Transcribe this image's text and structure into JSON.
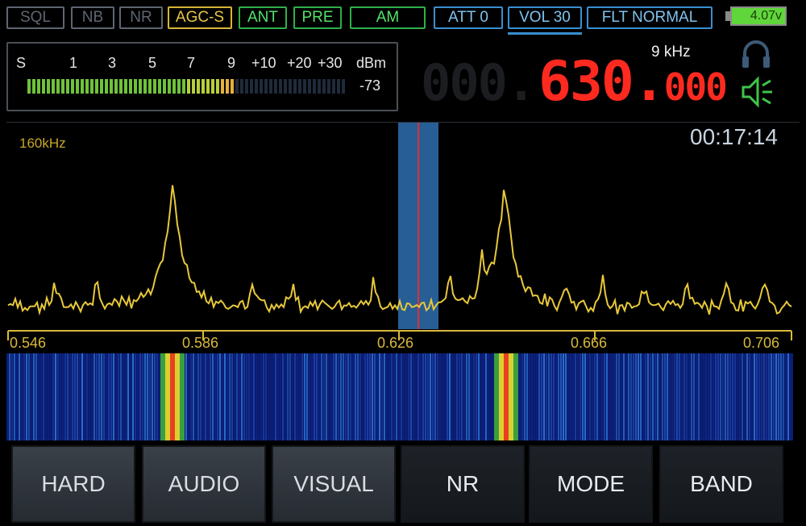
{
  "top_bar": {
    "sql": "SQL",
    "nb": "NB",
    "nr": "NR",
    "agc": "AGC-S",
    "ant": "ANT",
    "pre": "PRE",
    "mode": "AM",
    "att": "ATT 0",
    "vol": "VOL 30",
    "filter": "FLT NORMAL",
    "battery": "4.07v"
  },
  "smeter": {
    "scale": [
      "S",
      "1",
      "3",
      "5",
      "7",
      "9",
      "+10",
      "+20",
      "+30"
    ],
    "unit": "dBm",
    "value": "-73",
    "level_fraction": 0.65
  },
  "frequency": {
    "dim_prefix": "000.",
    "main": "630.",
    "fraction": "000",
    "step": "9 kHz"
  },
  "spectrum": {
    "span": "160kHz",
    "time": "00:17:14",
    "axis_labels": [
      "0.546",
      "0.586",
      "0.626",
      "0.666",
      "0.706"
    ]
  },
  "menu": {
    "hard": "HARD",
    "audio": "AUDIO",
    "visual": "VISUAL",
    "nr": "NR",
    "mode": "MODE",
    "band": "BAND"
  },
  "colors": {
    "accent_blue": "#3a8fd0",
    "frequency_red": "#ff2a1f",
    "trace_yellow": "#e8c83a"
  }
}
